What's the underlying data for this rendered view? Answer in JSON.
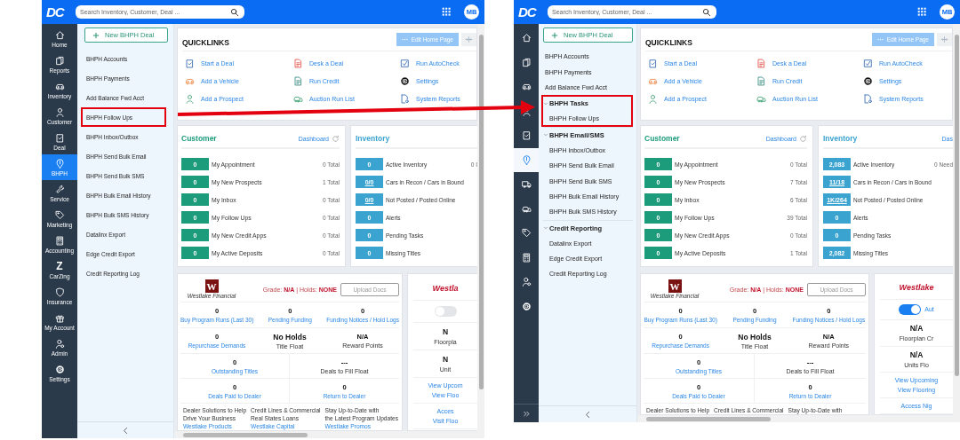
{
  "panels": [
    {
      "header": {
        "logo": "DC",
        "search": {
          "placeholder": "Search Inventory, Customer, Deal ..."
        },
        "avatar": "MB"
      },
      "nav": {
        "collapsed": false,
        "items": [
          {
            "kind": "home",
            "label": "Home",
            "selected": false
          },
          {
            "kind": "reports",
            "label": "Reports",
            "selected": false
          },
          {
            "kind": "car",
            "label": "Inventory",
            "selected": false
          },
          {
            "kind": "person",
            "label": "Customer",
            "selected": false
          },
          {
            "kind": "deal",
            "label": "Deal",
            "selected": false
          },
          {
            "kind": "bhph",
            "label": "BHPH",
            "selected": true
          },
          {
            "kind": "wrench",
            "label": "Service",
            "selected": false
          },
          {
            "kind": "tag",
            "label": "Marketing",
            "selected": false
          },
          {
            "kind": "calculator",
            "label": "Accounting",
            "selected": false
          },
          {
            "kind": "glyph",
            "glyph": "Z",
            "label": "CarZing",
            "selected": false
          },
          {
            "kind": "shield",
            "label": "Insurance",
            "selected": false
          },
          {
            "kind": "gift",
            "label": "My Account",
            "selected": false
          },
          {
            "kind": "admin",
            "label": "Admin",
            "selected": false
          },
          {
            "kind": "gear",
            "label": "Settings",
            "selected": false
          }
        ]
      },
      "submenu": {
        "new_button": "New BHPH Deal",
        "items": [
          {
            "kind": "link",
            "label": "BHPH Accounts",
            "annotated": false
          },
          {
            "kind": "link",
            "label": "BHPH Payments",
            "annotated": false
          },
          {
            "kind": "link",
            "label": "Add Balance Fwd Acct",
            "annotated": false
          },
          {
            "kind": "link",
            "label": "BHPH Follow Ups",
            "annotated": true
          },
          {
            "kind": "link",
            "label": "BHPH Inbox/Outbox",
            "annotated": false
          },
          {
            "kind": "link",
            "label": "BHPH Send Bulk Email",
            "annotated": false
          },
          {
            "kind": "link",
            "label": "BHPH Send Bulk SMS",
            "annotated": false
          },
          {
            "kind": "link",
            "label": "BHPH Bulk Email History",
            "annotated": false
          },
          {
            "kind": "link",
            "label": "BHPH Bulk SMS History",
            "annotated": false
          },
          {
            "kind": "link",
            "label": "Datalinx Export",
            "annotated": false
          },
          {
            "kind": "link",
            "label": "Edge Credit Export",
            "annotated": false
          },
          {
            "kind": "link",
            "label": "Credit Reporting Log",
            "annotated": false
          }
        ]
      },
      "quicklinks": {
        "title": "QUICKLINKS",
        "edit_button": "Edit Home Page",
        "links": [
          {
            "kind": "clipboard",
            "label": "Start a Deal"
          },
          {
            "kind": "desk",
            "label": "Desk a Deal"
          },
          {
            "kind": "checkbox",
            "label": "Run AutoCheck"
          },
          {
            "kind": "car",
            "label": "Add a Vehicle"
          },
          {
            "kind": "document",
            "label": "Run Credit"
          },
          {
            "kind": "gear",
            "label": "Settings"
          },
          {
            "kind": "person",
            "label": "Add a Prospect"
          },
          {
            "kind": "cars",
            "label": "Auction Run List"
          },
          {
            "kind": "report",
            "label": "System Reports"
          }
        ]
      },
      "customer": {
        "title": "Customer",
        "link": "Dashboard",
        "rows": [
          {
            "count": "0",
            "label": "My Appointment",
            "total": "0 Total"
          },
          {
            "count": "0",
            "label": "My New Prospects",
            "total": "1 Total"
          },
          {
            "count": "0",
            "label": "My Inbox",
            "total": "0 Total"
          },
          {
            "count": "0",
            "label": "My Follow Ups",
            "total": "0 Total"
          },
          {
            "count": "0",
            "label": "My New Credit Apps",
            "total": "0 Total"
          },
          {
            "count": "0",
            "label": "My Active Deposits",
            "total": "0 Total"
          }
        ]
      },
      "inventory": {
        "title": "Inventory",
        "rows": [
          {
            "count": "0",
            "link": false,
            "label": "Active Inventory",
            "extra": "0 I"
          },
          {
            "count": "0/0",
            "link": true,
            "label": "Cars in Recon / Cars in Bound"
          },
          {
            "count": "0/0",
            "link": true,
            "label": "Not Posted / Posted Online"
          },
          {
            "count": "0",
            "link": false,
            "label": "Alerts"
          },
          {
            "count": "0",
            "link": false,
            "label": "Pending Tasks"
          },
          {
            "count": "0",
            "link": false,
            "label": "Missing Titles"
          }
        ]
      },
      "westlake": {
        "logo_letter": "W",
        "logo_text": "Westlake Financial",
        "grade": "Grade: **N/A** | Holds: **NONE**",
        "upload_button": "Upload Docs",
        "rows": [
          [
            {
              "value": "0",
              "label": "Buy Program Runs (Last 30)",
              "link": true
            },
            {
              "value": "0",
              "label": "Pending Funding",
              "link": true
            },
            {
              "value": "0",
              "label": "Funding Notices / Hold Logs",
              "link": true
            }
          ],
          [
            {
              "value": "0",
              "label": "Repurchase Demands",
              "link": true
            },
            {
              "value": "No Holds",
              "label": "Title Float",
              "link": false
            },
            {
              "value": "N/A",
              "label": "Reward Points",
              "link": false
            }
          ],
          [
            {
              "value": "0",
              "label": "Outstanding Titles",
              "link": true
            },
            {
              "value": "---",
              "label": "Deals to Fill Float",
              "link": false
            }
          ],
          [
            {
              "value": "0",
              "label": "Deals Paid to Dealer",
              "link": true
            },
            {
              "value": "0",
              "label": "Return to Dealer",
              "link": true
            }
          ]
        ],
        "promos": [
          {
            "lines": [
              "Dealer Solutions to Help",
              "Drive Your Business"
            ],
            "link": "Westlake Products"
          },
          {
            "lines": [
              "Credit Lines & Commercial",
              "Real States Loans"
            ],
            "link": "Westlake Capital"
          },
          {
            "lines": [
              "Stay Up-to-Date with",
              "the Latest Program Updates"
            ],
            "link": "Westlake Promos"
          }
        ]
      },
      "flooring": {
        "logo_text": "Westla",
        "toggle": {
          "on": false
        },
        "stats": [
          {
            "value": "N",
            "label": "Floorpla"
          },
          {
            "value": "N",
            "label": "Unit"
          }
        ],
        "link_groups": [
          [
            "View Upcom",
            "View Floo"
          ],
          [
            "Acces",
            "Visit Floo"
          ]
        ]
      }
    },
    {
      "header": {
        "logo": "DC",
        "search": {
          "placeholder": "Search Inventory, Customer, Deal ..."
        },
        "avatar": "MB"
      },
      "nav": {
        "collapsed": true,
        "items": [
          {
            "kind": "home",
            "selected": false
          },
          {
            "kind": "reports",
            "selected": false
          },
          {
            "kind": "car",
            "selected": false
          },
          {
            "kind": "person",
            "selected": false
          },
          {
            "kind": "deal",
            "selected": false
          },
          {
            "kind": "bhph",
            "selected": true
          },
          {
            "kind": "truck",
            "selected": false
          },
          {
            "kind": "cars",
            "selected": false
          },
          {
            "kind": "tag",
            "selected": false
          },
          {
            "kind": "calculator",
            "selected": false
          },
          {
            "kind": "admin",
            "selected": false
          },
          {
            "kind": "gear",
            "selected": false
          }
        ]
      },
      "submenu": {
        "new_button": "New BHPH Deal",
        "items": [
          {
            "kind": "link",
            "label": "BHPH Accounts",
            "annotated": false
          },
          {
            "kind": "link",
            "label": "BHPH Payments",
            "annotated": false
          },
          {
            "kind": "link",
            "label": "Add Balance Fwd Acct",
            "annotated": false
          },
          {
            "kind": "group",
            "label": "BHPH Tasks",
            "expanded": true,
            "annotated": true,
            "children": [
              {
                "kind": "link",
                "label": "BHPH Follow Ups",
                "annotated": false
              }
            ]
          },
          {
            "kind": "group",
            "label": "BHPH Email/SMS",
            "expanded": true,
            "annotated": false,
            "children": [
              {
                "kind": "link",
                "label": "BHPH Inbox/Outbox",
                "annotated": false
              },
              {
                "kind": "link",
                "label": "BHPH Send Bulk Email",
                "annotated": false
              },
              {
                "kind": "link",
                "label": "BHPH Send Bulk SMS",
                "annotated": false
              },
              {
                "kind": "link",
                "label": "BHPH Bulk Email History",
                "annotated": false
              },
              {
                "kind": "link",
                "label": "BHPH Bulk SMS History",
                "annotated": false
              }
            ]
          },
          {
            "kind": "group",
            "label": "Credit Reporting",
            "expanded": true,
            "annotated": false,
            "children": [
              {
                "kind": "link",
                "label": "Datalinx Export",
                "annotated": false
              },
              {
                "kind": "link",
                "label": "Edge Credit Export",
                "annotated": false
              },
              {
                "kind": "link",
                "label": "Credit Reporting Log",
                "annotated": false
              }
            ]
          }
        ]
      },
      "quicklinks": {
        "title": "QUICKLINKS",
        "edit_button": "Edit Home Page",
        "links": [
          {
            "kind": "clipboard",
            "label": "Start a Deal"
          },
          {
            "kind": "desk",
            "label": "Desk a Deal"
          },
          {
            "kind": "checkbox",
            "label": "Run AutoCheck"
          },
          {
            "kind": "car",
            "label": "Add a Vehicle"
          },
          {
            "kind": "document",
            "label": "Run Credit"
          },
          {
            "kind": "gear",
            "label": "Settings"
          },
          {
            "kind": "person",
            "label": "Add a Prospect"
          },
          {
            "kind": "cars",
            "label": "Auction Run List"
          },
          {
            "kind": "report",
            "label": "System Reports"
          }
        ]
      },
      "customer": {
        "title": "Customer",
        "link": "Dashboard",
        "rows": [
          {
            "count": "0",
            "label": "My Appointment",
            "total": "0 Total"
          },
          {
            "count": "0",
            "label": "My New Prospects",
            "total": "7 Total"
          },
          {
            "count": "0",
            "label": "My Inbox",
            "total": "6 Total"
          },
          {
            "count": "0",
            "label": "My Follow Ups",
            "total": "39 Total"
          },
          {
            "count": "0",
            "label": "My New Credit Apps",
            "total": "0 Total"
          },
          {
            "count": "0",
            "label": "My Active Deposits",
            "total": "1 Total"
          }
        ]
      },
      "inventory": {
        "title": "Inventory",
        "link": "Das",
        "rows": [
          {
            "count": "2,083",
            "link": false,
            "label": "Active Inventory",
            "extra": "0 Need"
          },
          {
            "count": "11/18",
            "link": true,
            "label": "Cars in Recon / Cars in Bound"
          },
          {
            "count": "1K/264",
            "link": true,
            "label": "Not Posted / Posted Online"
          },
          {
            "count": "0",
            "link": false,
            "label": "Alerts"
          },
          {
            "count": "0",
            "link": false,
            "label": "Pending Tasks"
          },
          {
            "count": "2,082",
            "link": false,
            "label": "Missing Titles"
          }
        ]
      },
      "westlake": {
        "logo_letter": "W",
        "logo_text": "Westlake Financial",
        "grade": "Grade: **N/A** | Holds: **NONE**",
        "upload_button": "Upload Docs",
        "rows": [
          [
            {
              "value": "0",
              "label": "Buy Program Runs (Last 30)",
              "link": true
            },
            {
              "value": "0",
              "label": "Pending Funding",
              "link": true
            },
            {
              "value": "0",
              "label": "Funding Notices / Hold Logs",
              "link": true
            }
          ],
          [
            {
              "value": "0",
              "label": "Repurchase Demands",
              "link": true
            },
            {
              "value": "No Holds",
              "label": "Title Float",
              "link": false
            },
            {
              "value": "N/A",
              "label": "Reward Points",
              "link": false
            }
          ],
          [
            {
              "value": "0",
              "label": "Outstanding Titles",
              "link": true
            },
            {
              "value": "---",
              "label": "Deals to Fill Float",
              "link": false
            }
          ],
          [
            {
              "value": "0",
              "label": "Deals Paid to Dealer",
              "link": true
            },
            {
              "value": "0",
              "label": "Return to Dealer",
              "link": true
            }
          ]
        ],
        "promos": [
          {
            "lines": [
              "Dealer Solutions to Help"
            ]
          },
          {
            "lines": [
              "Credit Lines & Commercial"
            ]
          },
          {
            "lines": [
              "Stay Up-to-Date with"
            ]
          }
        ]
      },
      "flooring": {
        "logo_text": "Westlake",
        "toggle": {
          "on": true,
          "label": "Aut"
        },
        "stats": [
          {
            "value": "N/A",
            "label": "Floorplan Cr"
          },
          {
            "value": "N/A",
            "label": "Units Flo"
          }
        ],
        "link_groups": [
          [
            "View Upcoming",
            "View Flooring"
          ],
          [
            "Access Nig"
          ]
        ]
      }
    }
  ]
}
